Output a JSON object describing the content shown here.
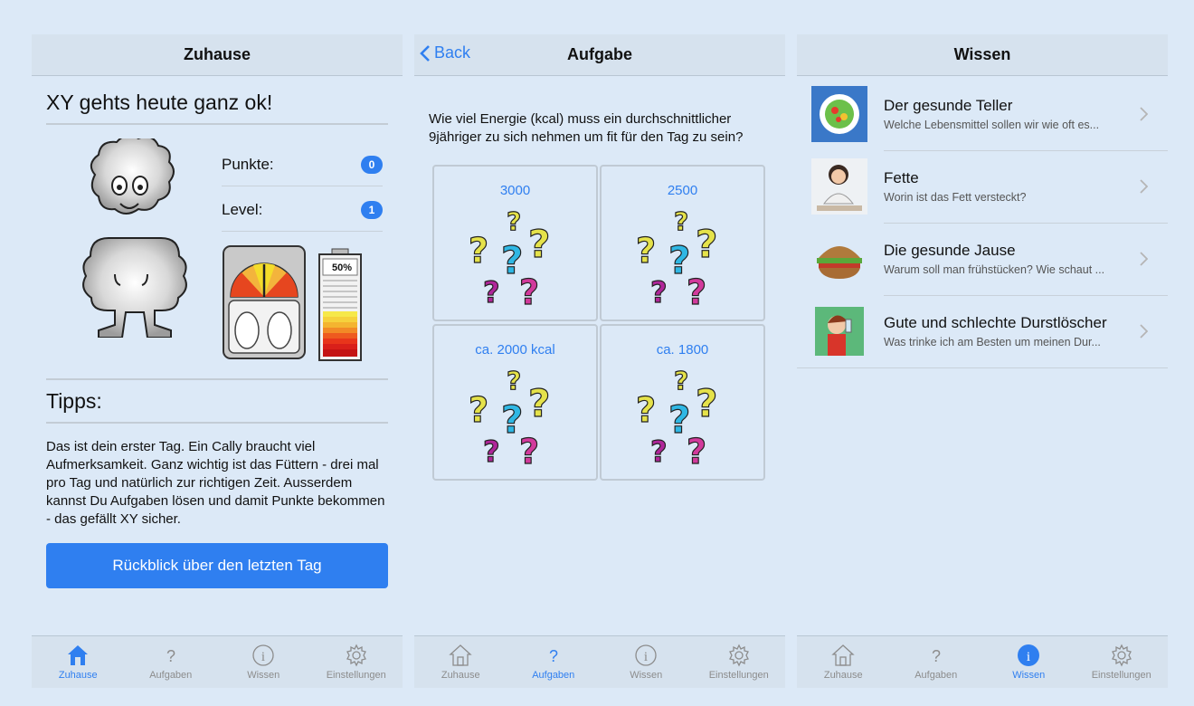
{
  "screens": {
    "home": {
      "title": "Zuhause",
      "heading": "XY gehts heute ganz ok!",
      "points_label": "Punkte:",
      "points_value": "0",
      "level_label": "Level:",
      "level_value": "1",
      "battery_percent": "50%",
      "tips_heading": "Tipps:",
      "tips_text": "Das ist dein erster Tag. Ein Cally braucht viel Aufmerksamkeit. Ganz wichtig ist das Füttern - drei mal pro Tag und natürlich zur richtigen Zeit. Ausserdem kannst Du Aufgaben lösen und damit Punkte bekommen - das gefällt XY sicher.",
      "button_label": "Rückblick über den letzten Tag"
    },
    "task": {
      "back_label": "Back",
      "title": "Aufgabe",
      "question": "Wie viel Energie (kcal) muss ein durchschnittlicher 9jähriger zu sich nehmen um fit für den Tag zu sein?",
      "answers": [
        "3000",
        "2500",
        "ca. 2000 kcal",
        "ca. 1800"
      ]
    },
    "knowledge": {
      "title": "Wissen",
      "items": [
        {
          "title": "Der gesunde Teller",
          "subtitle": "Welche Lebensmittel sollen wir wie oft es..."
        },
        {
          "title": "Fette",
          "subtitle": "Worin ist das Fett versteckt?"
        },
        {
          "title": "Die gesunde Jause",
          "subtitle": "Warum soll man frühstücken? Wie schaut ..."
        },
        {
          "title": "Gute und schlechte Durstlöscher",
          "subtitle": "Was trinke ich am Besten um meinen Dur..."
        }
      ]
    }
  },
  "tabbar": {
    "labels": [
      "Zuhause",
      "Aufgaben",
      "Wissen",
      "Einstellungen"
    ],
    "icons": [
      "home-icon",
      "question-mark-icon",
      "info-icon",
      "gear-icon"
    ]
  },
  "colors": {
    "accent": "#2f7ff0",
    "background": "#dce9f7",
    "bar": "#d6e2ee"
  }
}
